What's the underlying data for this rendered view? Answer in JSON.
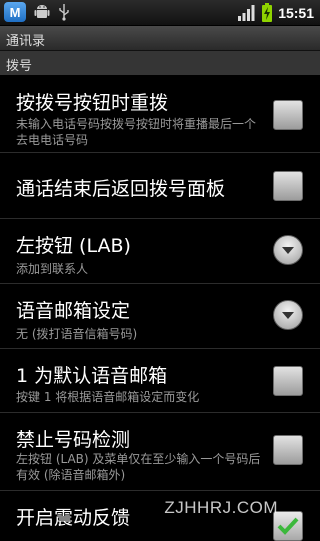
{
  "status_bar": {
    "time": "15:51"
  },
  "header": {
    "title": "通讯录"
  },
  "section": {
    "label": "拨号"
  },
  "settings": [
    {
      "title": "按拨号按钮时重拨",
      "summary": "未输入电话号码按拨号按钮时将重播最后一个去电电话号码",
      "control": "checkbox",
      "checked": false
    },
    {
      "title": "通话结束后返回拨号面板",
      "summary": "",
      "control": "checkbox",
      "checked": false
    },
    {
      "title": "左按钮 (LAB)",
      "summary": "添加到联系人",
      "control": "dropdown"
    },
    {
      "title": "语音邮箱设定",
      "summary": "无 (拨打语音信箱号码)",
      "control": "dropdown"
    },
    {
      "title": "1 为默认语音邮箱",
      "summary": "按键 1 将根据语音邮箱设定而变化",
      "control": "checkbox",
      "checked": false
    },
    {
      "title": "禁止号码检测",
      "summary": "左按钮 (LAB) 及菜单仅在至少输入一个号码后有效 (除语音邮箱外)",
      "control": "checkbox",
      "checked": false
    },
    {
      "title": "开启震动反馈",
      "summary": "",
      "control": "checkbox",
      "checked": true
    }
  ],
  "watermark": "ZJHHRJ.COM",
  "colors": {
    "accent_check": "#3cb83c",
    "battery": "#8fd400",
    "app_icon": "#2e86de"
  }
}
